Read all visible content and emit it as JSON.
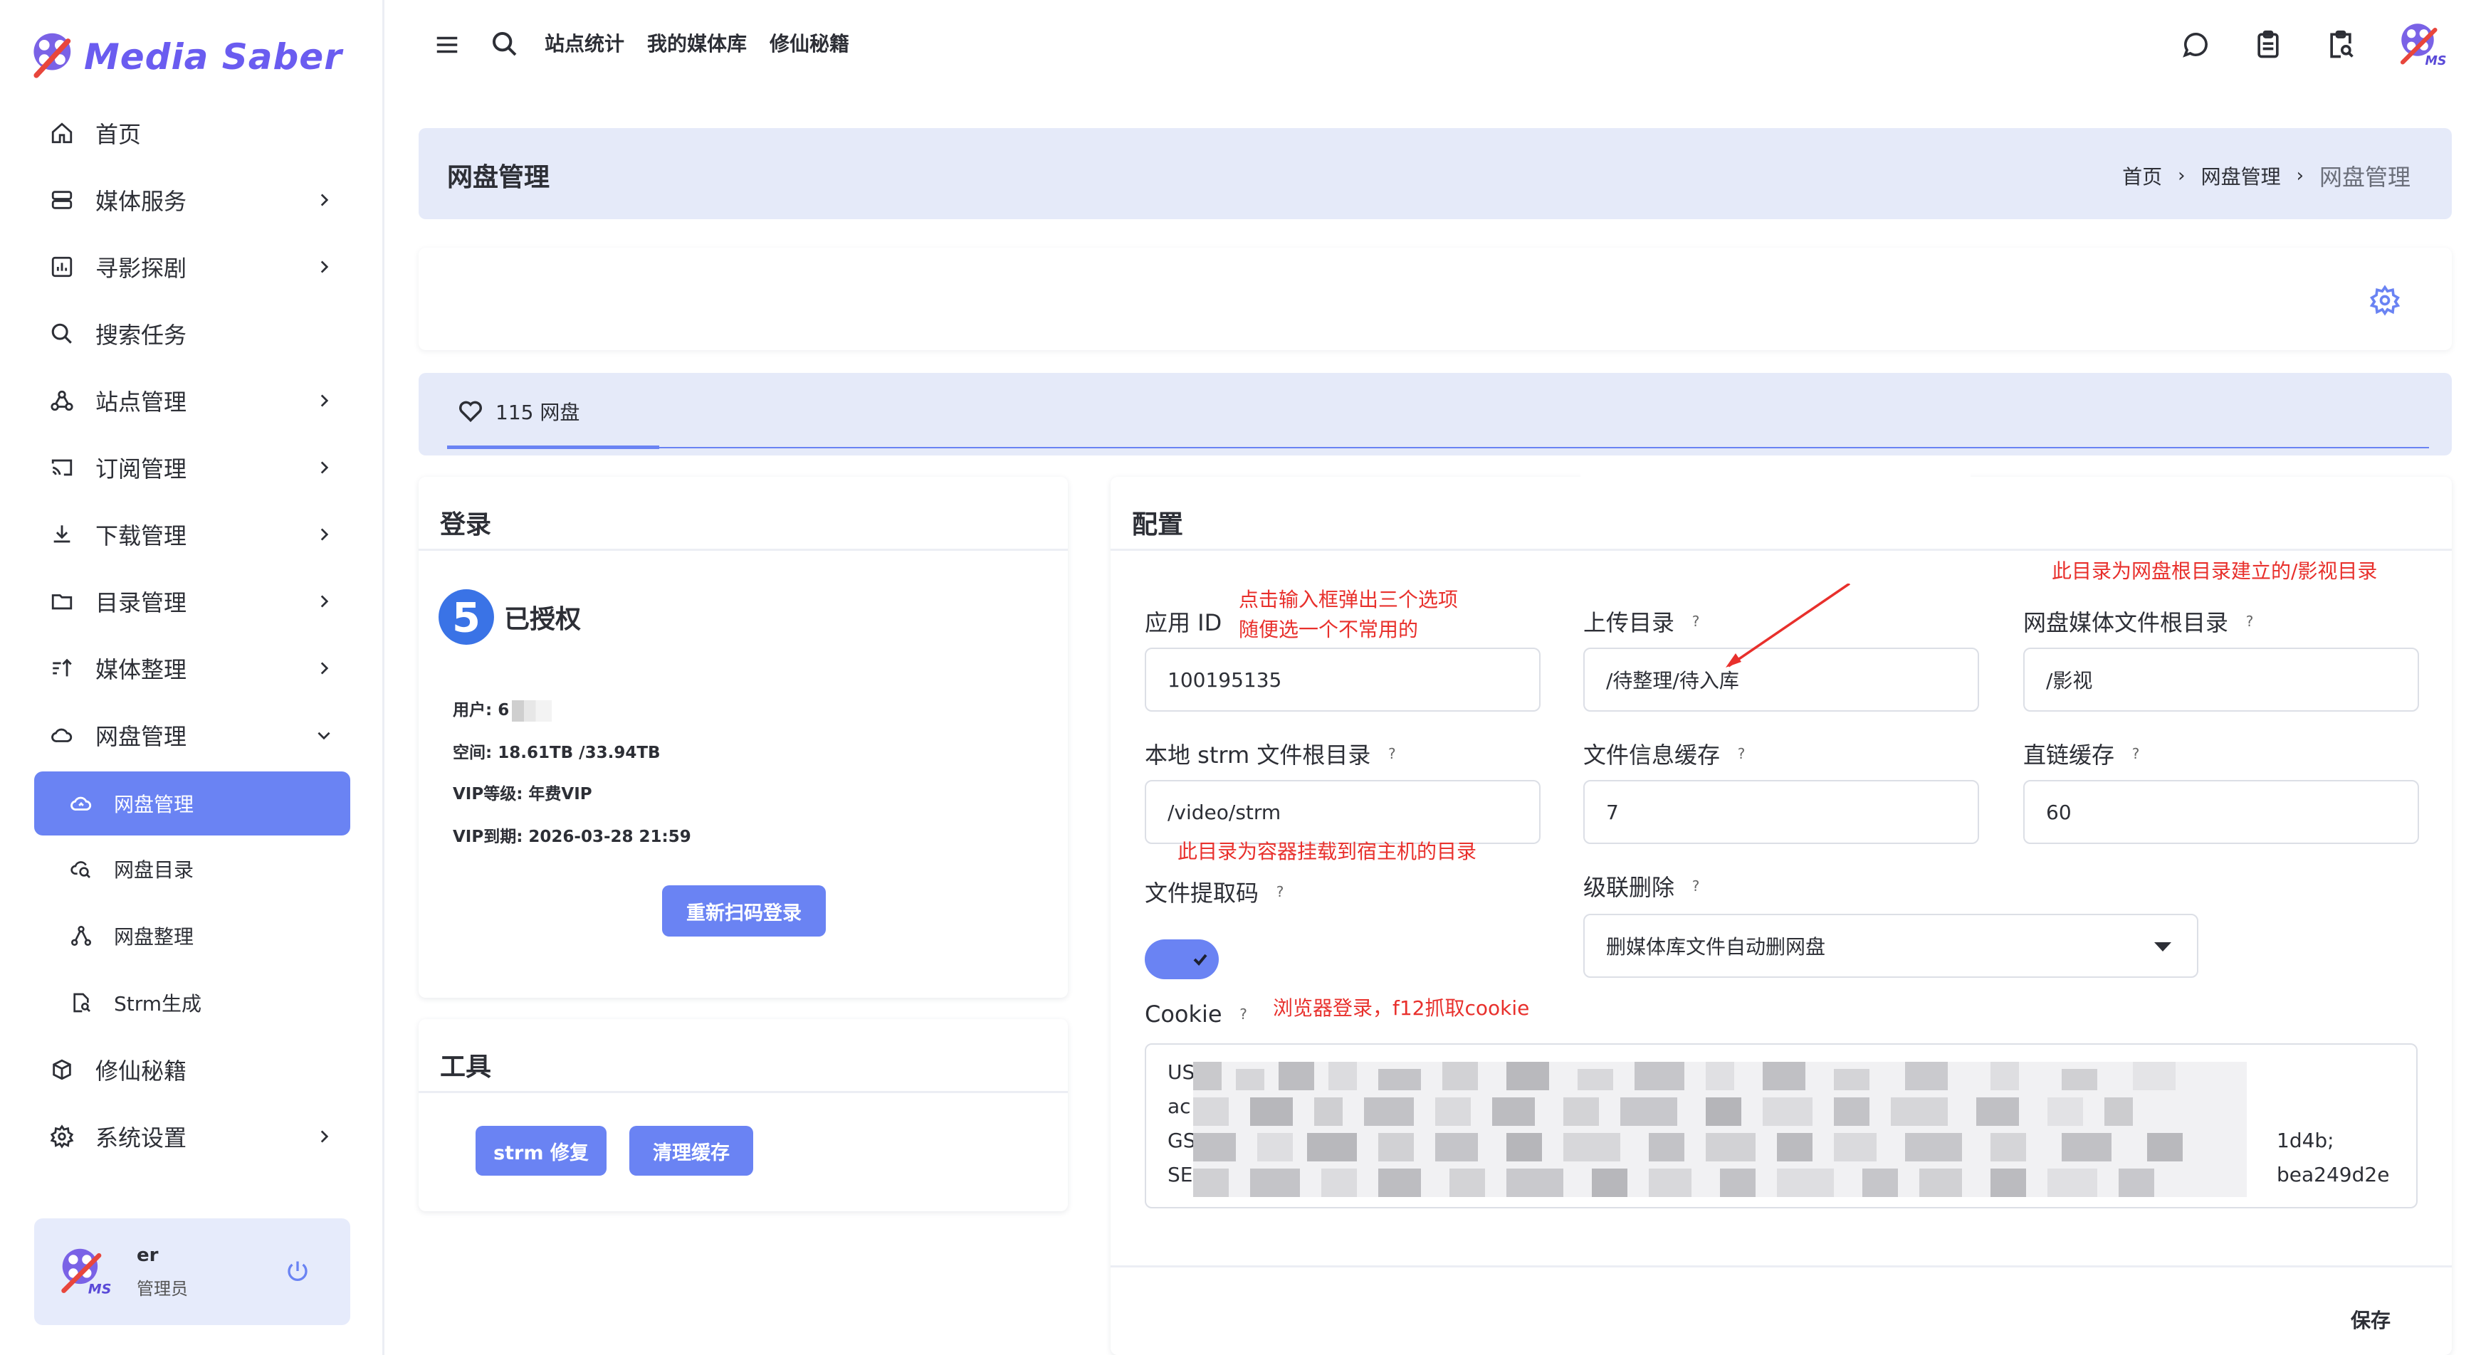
{
  "app": {
    "logo_text": "Media Saber"
  },
  "sidebar": {
    "items": [
      {
        "label": "首页",
        "icon": "home-icon"
      },
      {
        "label": "媒体服务",
        "icon": "server-icon"
      },
      {
        "label": "寻影探剧",
        "icon": "chart-icon"
      },
      {
        "label": "搜索任务",
        "icon": "search-icon"
      },
      {
        "label": "站点管理",
        "icon": "sites-icon"
      },
      {
        "label": "订阅管理",
        "icon": "cast-icon"
      },
      {
        "label": "下载管理",
        "icon": "download-icon"
      },
      {
        "label": "目录管理",
        "icon": "folder-icon"
      },
      {
        "label": "媒体整理",
        "icon": "sort-icon"
      },
      {
        "label": "网盘管理",
        "icon": "cloud-icon"
      }
    ],
    "sub_items": [
      {
        "label": "网盘管理",
        "icon": "cloud-sync-icon"
      },
      {
        "label": "网盘目录",
        "icon": "cloud-search-icon"
      },
      {
        "label": "网盘整理",
        "icon": "organize-icon"
      },
      {
        "label": "Strm生成",
        "icon": "file-search-icon"
      }
    ],
    "bottom_items": [
      {
        "label": "修仙秘籍",
        "icon": "box-icon"
      },
      {
        "label": "系统设置",
        "icon": "settings-icon"
      }
    ],
    "user": {
      "name": "er",
      "role": "管理员"
    }
  },
  "header": {
    "links": [
      "站点统计",
      "我的媒体库",
      "修仙秘籍"
    ]
  },
  "page": {
    "title": "网盘管理",
    "breadcrumb": [
      "首页",
      "网盘管理",
      "网盘管理"
    ],
    "tab": "115 网盘"
  },
  "login": {
    "title": "登录",
    "status": "已授权",
    "user_label": "用户: 6",
    "space": "空间: 18.61TB /33.94TB",
    "vip_level": "VIP等级: 年费VIP",
    "vip_expire": "VIP到期: 2026-03-28 21:59",
    "rescan_button": "重新扫码登录"
  },
  "tools": {
    "title": "工具",
    "strm_button": "strm 修复",
    "clear_button": "清理缓存"
  },
  "config": {
    "title": "配置",
    "app_id_label": "应用 ID",
    "app_id_value": "100195135",
    "upload_dir_label": "上传目录",
    "upload_dir_value": "/待整理/待入库",
    "root_dir_label": "网盘媒体文件根目录",
    "root_dir_value": "/影视",
    "strm_dir_label": "本地 strm 文件根目录",
    "strm_dir_value": "/video/strm",
    "file_cache_label": "文件信息缓存",
    "file_cache_value": "7",
    "link_cache_label": "直链缓存",
    "link_cache_value": "60",
    "extract_code_label": "文件提取码",
    "extract_code_enabled": true,
    "cascade_label": "级联删除",
    "cascade_value": "删媒体库文件自动删网盘",
    "cookie_label": "Cookie",
    "cookie_lines": [
      "US",
      "ac",
      "GS",
      "SE"
    ],
    "cookie_tail": [
      "1d4b;",
      "bea249d2e"
    ],
    "save_button": "保存",
    "annotations": {
      "app_id_note_1": "点击输入框弹出三个选项",
      "app_id_note_2": "随便选一个不常用的",
      "root_dir_note": "此目录为网盘根目录建立的/影视目录",
      "strm_note": "此目录为容器挂载到宿主机的目录",
      "cookie_note": "浏览器登录，f12抓取cookie"
    }
  },
  "colors": {
    "accent": "#6a83f3",
    "title_bg": "#e5eaf9",
    "annotation": "#e8302c",
    "logo": "#6a5cf0"
  }
}
